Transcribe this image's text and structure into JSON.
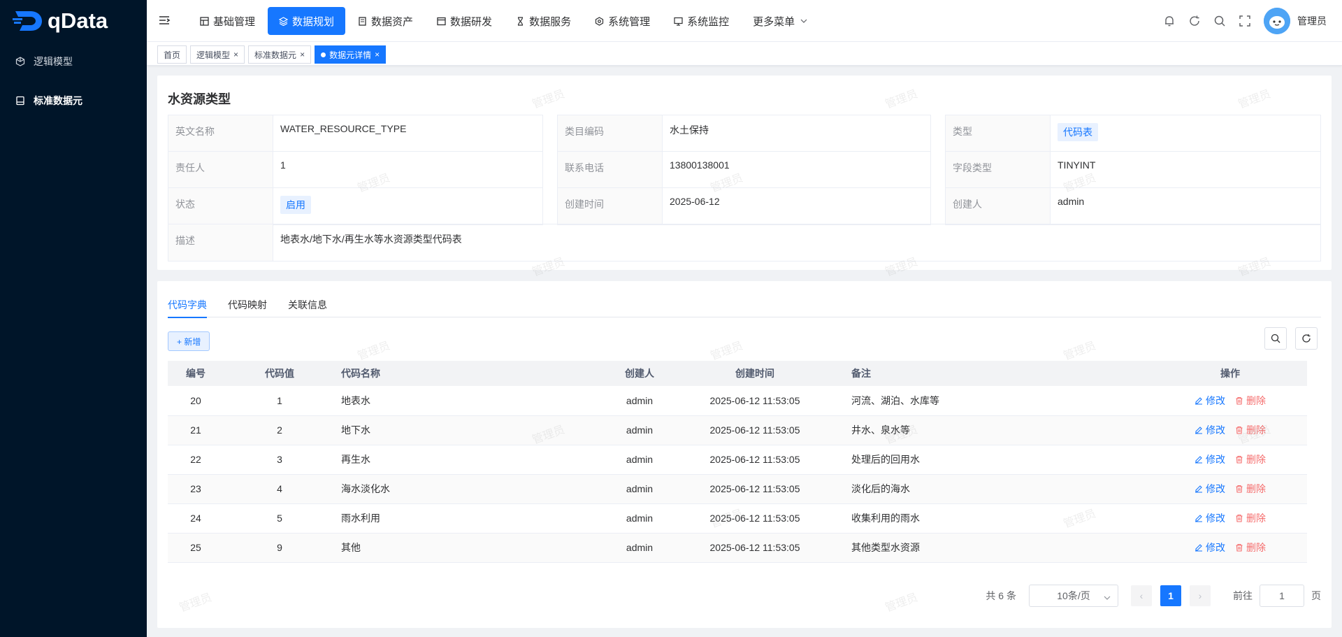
{
  "app": {
    "logo_text": "qData",
    "user_name": "管理员",
    "watermark_text": "管理员"
  },
  "sidebar": {
    "items": [
      {
        "label": "逻辑模型",
        "icon": "cube-icon",
        "active": false
      },
      {
        "label": "标准数据元",
        "icon": "database-icon",
        "active": true
      }
    ]
  },
  "nav": {
    "items": [
      {
        "label": "基础管理",
        "icon": "grid-icon",
        "active": false
      },
      {
        "label": "数据规划",
        "icon": "layers-icon",
        "active": true
      },
      {
        "label": "数据资产",
        "icon": "document-icon",
        "active": false
      },
      {
        "label": "数据研发",
        "icon": "window-icon",
        "active": false
      },
      {
        "label": "数据服务",
        "icon": "hourglass-icon",
        "active": false
      },
      {
        "label": "系统管理",
        "icon": "settings-icon",
        "active": false
      },
      {
        "label": "系统监控",
        "icon": "monitor-icon",
        "active": false
      },
      {
        "label": "更多菜单",
        "icon": "chevron-down-icon",
        "active": false
      }
    ]
  },
  "tags": [
    {
      "label": "首页",
      "closable": false,
      "active": false
    },
    {
      "label": "逻辑模型",
      "closable": true,
      "active": false
    },
    {
      "label": "标准数据元",
      "closable": true,
      "active": false
    },
    {
      "label": "数据元详情",
      "closable": true,
      "active": true
    }
  ],
  "detail": {
    "title": "水资源类型",
    "fields": {
      "en_name": {
        "label": "英文名称",
        "value": "WATER_RESOURCE_TYPE"
      },
      "owner": {
        "label": "责任人",
        "value": "1"
      },
      "status": {
        "label": "状态",
        "value": "启用"
      },
      "catalog_code": {
        "label": "类目编码",
        "value": "水土保持"
      },
      "phone": {
        "label": "联系电话",
        "value": "13800138001"
      },
      "created_at": {
        "label": "创建时间",
        "value": "2025-06-12"
      },
      "type": {
        "label": "类型",
        "value": "代码表"
      },
      "field_type": {
        "label": "字段类型",
        "value": "TINYINT"
      },
      "creator": {
        "label": "创建人",
        "value": "admin"
      },
      "description": {
        "label": "描述",
        "value": "地表水/地下水/再生水等水资源类型代码表"
      }
    }
  },
  "tabs": [
    "代码字典",
    "代码映射",
    "关联信息"
  ],
  "toolbar": {
    "add_label": "+ 新增"
  },
  "table": {
    "columns": [
      "编号",
      "代码值",
      "代码名称",
      "创建人",
      "创建时间",
      "备注",
      "操作"
    ],
    "edit_label": "修改",
    "delete_label": "删除",
    "rows": [
      {
        "id": "20",
        "code": "1",
        "name": "地表水",
        "creator": "admin",
        "time": "2025-06-12 11:53:05",
        "note": "河流、湖泊、水库等"
      },
      {
        "id": "21",
        "code": "2",
        "name": "地下水",
        "creator": "admin",
        "time": "2025-06-12 11:53:05",
        "note": "井水、泉水等"
      },
      {
        "id": "22",
        "code": "3",
        "name": "再生水",
        "creator": "admin",
        "time": "2025-06-12 11:53:05",
        "note": "处理后的回用水"
      },
      {
        "id": "23",
        "code": "4",
        "name": "海水淡化水",
        "creator": "admin",
        "time": "2025-06-12 11:53:05",
        "note": "淡化后的海水"
      },
      {
        "id": "24",
        "code": "5",
        "name": "雨水利用",
        "creator": "admin",
        "time": "2025-06-12 11:53:05",
        "note": "收集利用的雨水"
      },
      {
        "id": "25",
        "code": "9",
        "name": "其他",
        "creator": "admin",
        "time": "2025-06-12 11:53:05",
        "note": "其他类型水资源"
      }
    ]
  },
  "pagination": {
    "total": "共 6 条",
    "page_size": "10条/页",
    "current": "1",
    "goto_label": "前往",
    "goto_value": "1",
    "page_unit": "页"
  },
  "colors": {
    "primary": "#1677ff",
    "sidebar": "#001529",
    "danger": "#f56c6c"
  }
}
